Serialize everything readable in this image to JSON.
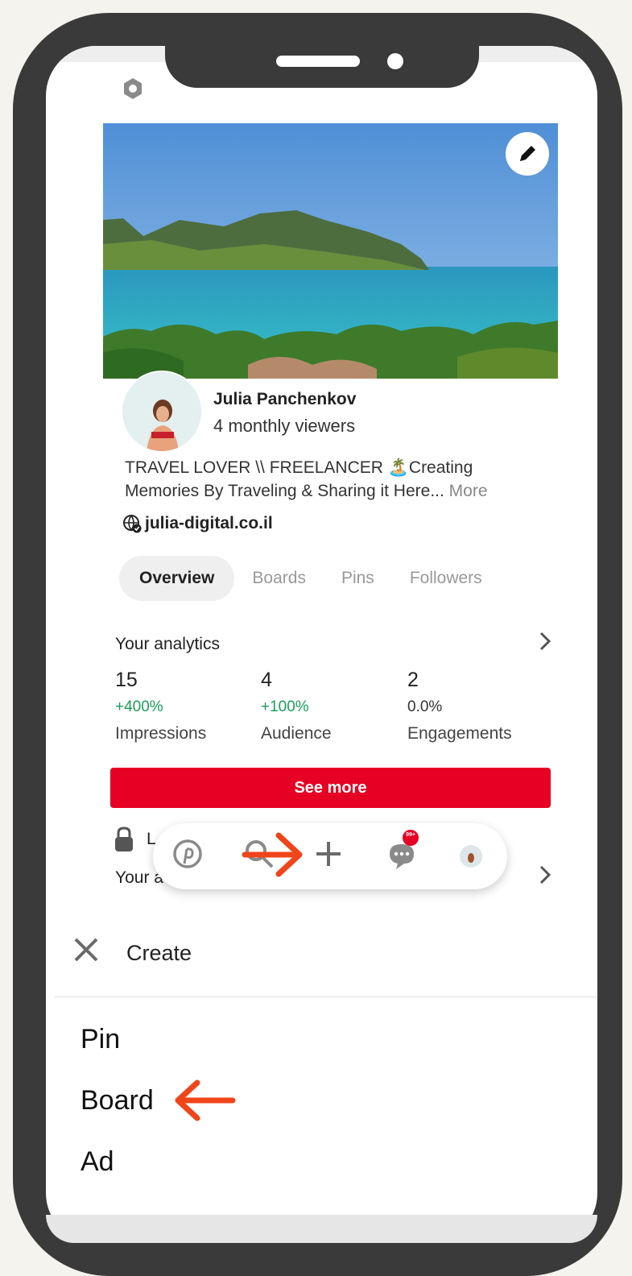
{
  "profile": {
    "name": "Julia Panchenkov",
    "viewers": "4 monthly viewers",
    "bio_text": "TRAVEL LOVER \\\\ FREELANCER 🏝️Creating Memories By Traveling & Sharing it Here...",
    "bio_more": "More",
    "website": "julia-digital.co.il"
  },
  "tabs": [
    {
      "label": "Overview",
      "active": true
    },
    {
      "label": "Boards",
      "active": false
    },
    {
      "label": "Pins",
      "active": false
    },
    {
      "label": "Followers",
      "active": false
    }
  ],
  "analytics": {
    "title": "Your analytics",
    "stats": [
      {
        "value": "15",
        "change": "+400%",
        "label": "Impressions"
      },
      {
        "value": "4",
        "change": "+100%",
        "label": "Audience"
      },
      {
        "value": "2",
        "change": "0.0%",
        "label": "Engagements"
      }
    ],
    "see_more": "See more"
  },
  "partial_labels": {
    "lock_row": "L",
    "your_row": "Your a"
  },
  "nav": {
    "icons": [
      "pinterest-logo-icon",
      "search-icon",
      "plus-icon",
      "chat-icon",
      "profile-avatar-icon"
    ],
    "chat_badge": "99+"
  },
  "create_menu": {
    "title": "Create",
    "options": [
      "Pin",
      "Board",
      "Ad"
    ]
  },
  "colors": {
    "brand_red": "#e60023",
    "positive_green": "#1a9e5a",
    "annotation_arrow": "#f0451a",
    "phone_frame": "#3a3a3a"
  }
}
